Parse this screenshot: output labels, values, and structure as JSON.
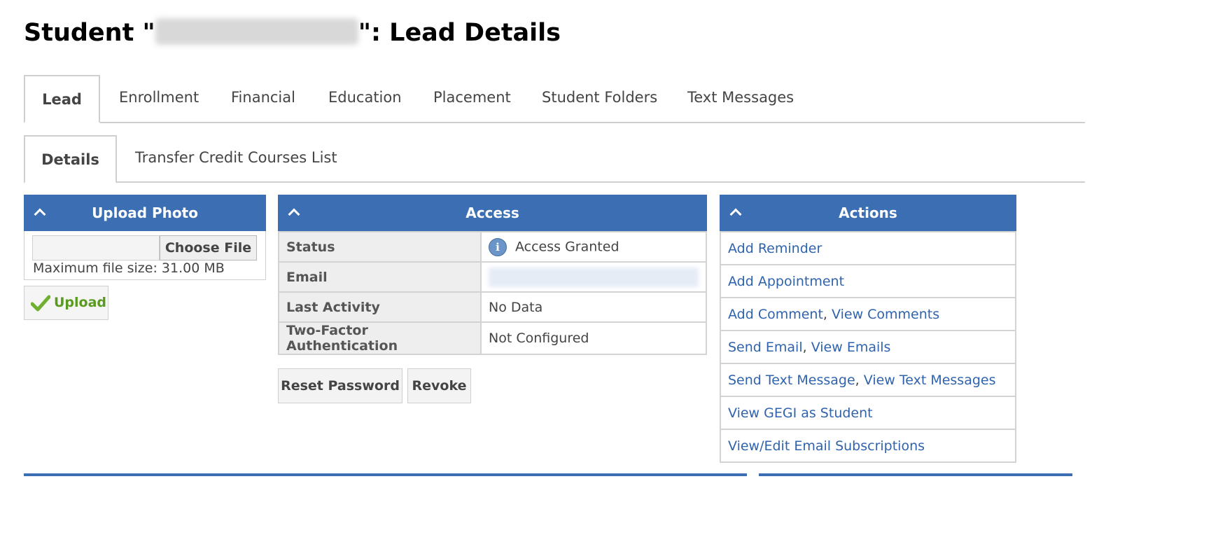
{
  "page": {
    "title_prefix": "Student \"",
    "title_suffix": "\": Lead Details"
  },
  "tabs": [
    "Lead",
    "Enrollment",
    "Financial",
    "Education",
    "Placement",
    "Student Folders",
    "Text Messages"
  ],
  "subtabs": [
    "Details",
    "Transfer Credit Courses List"
  ],
  "upload_panel": {
    "title": "Upload Photo",
    "choose_label": "Choose File",
    "max_size": "Maximum file size: 31.00 MB",
    "upload_label": "Upload"
  },
  "access_panel": {
    "title": "Access",
    "rows": [
      {
        "label": "Status",
        "value": "Access Granted"
      },
      {
        "label": "Email",
        "value": ""
      },
      {
        "label": "Last Activity",
        "value": "No Data"
      },
      {
        "label": "Two-Factor Authentication",
        "value": "Not Configured"
      }
    ],
    "reset_label": "Reset Password",
    "revoke_label": "Revoke"
  },
  "actions_panel": {
    "title": "Actions",
    "items": [
      {
        "a": "Add Reminder"
      },
      {
        "a": "Add Appointment"
      },
      {
        "a": "Add Comment",
        "b": "View Comments"
      },
      {
        "a": "Send Email",
        "b": "View Emails"
      },
      {
        "a": "Send Text Message",
        "b": "View Text Messages"
      },
      {
        "a": "View GEGI as Student"
      },
      {
        "a": "View/Edit Email Subscriptions"
      }
    ],
    "separator": ", "
  },
  "colors": {
    "panel_header": "#3c6eb4",
    "link": "#2f63ad",
    "upload_green": "#5a9b1f"
  }
}
